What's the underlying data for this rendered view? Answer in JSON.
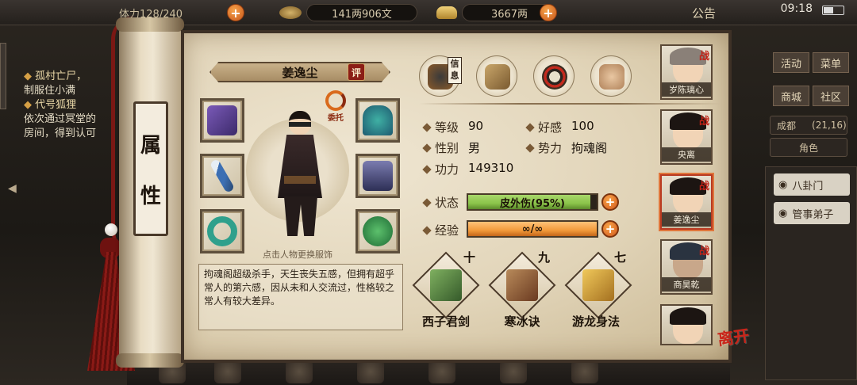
{
  "top_bar": {
    "stamina": "体力128/240",
    "money": "141两906文",
    "gold": "3667两",
    "notice": "公告",
    "clock": "09:18"
  },
  "quest": {
    "line1": "孤村亡尸，",
    "line2": "制服住小满",
    "line3": "代号狐狸",
    "line4": "依次通过冥堂的",
    "line5": "房间，得到认可"
  },
  "scroll_title": [
    "属",
    "性"
  ],
  "character": {
    "name": "姜逸尘",
    "eval_label": "评",
    "entrust_label": "委托",
    "hint": "点击人物更换服饰",
    "bio": "拘魂阁超级杀手，天生丧失五感，但拥有超乎常人的第六感，因从未和人交流过，性格较之常人有较大差异。"
  },
  "info_tag": "信息",
  "stats": {
    "level_label": "等级",
    "level": "90",
    "favor_label": "好感",
    "favor": "100",
    "gender_label": "性别",
    "gender": "男",
    "faction_label": "势力",
    "faction": "拘魂阁",
    "power_label": "功力",
    "power": "149310"
  },
  "bars": {
    "status_label": "状态",
    "status_text": "皮外伤(95%)",
    "status_fill": 0.95,
    "exp_label": "经验",
    "exp_text": "∞/∞",
    "exp_fill": 1.0
  },
  "martial": [
    {
      "level": "十",
      "name": "西子君剑"
    },
    {
      "level": "九",
      "name": "寒冰诀"
    },
    {
      "level": "七",
      "name": "游龙身法"
    }
  ],
  "party": [
    {
      "name": "岁陈璃心",
      "battle": "战"
    },
    {
      "name": "央离",
      "battle": "战"
    },
    {
      "name": "姜逸尘",
      "battle": "战"
    },
    {
      "name": "商昊乾",
      "battle": "战"
    },
    {
      "name": "",
      "battle": ""
    }
  ],
  "leave_label": "离开",
  "right_panel": {
    "btn1": "活动",
    "btn2": "菜单",
    "btn3": "商城",
    "btn4": "社区",
    "location": "成都",
    "coords": "(21,16)",
    "role": "角色",
    "list1": "八卦门",
    "list2": "管事弟子"
  },
  "colors": {
    "status_bar": "#8bc34a",
    "exp_bar": "#f29a3a",
    "accent": "#b83a22"
  }
}
